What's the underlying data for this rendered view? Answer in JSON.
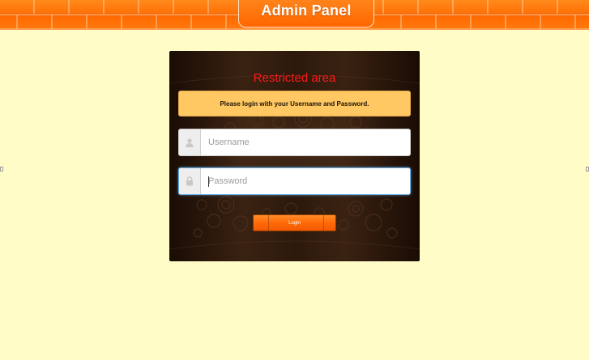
{
  "header": {
    "title": "Admin Panel"
  },
  "login_panel": {
    "heading": "Restricted area",
    "notice": "Please login with your Username and Password.",
    "username": {
      "placeholder": "Username",
      "value": "",
      "icon": "user-icon"
    },
    "password": {
      "placeholder": "Password",
      "value": "",
      "icon": "lock-icon"
    },
    "login_label": "Login"
  },
  "colors": {
    "background": "#fffcc8",
    "banner_orange": "#ff6a00",
    "heading_red": "#ff1a1a",
    "notice_bg": "#ffc862",
    "panel_dark": "#2c190c"
  }
}
